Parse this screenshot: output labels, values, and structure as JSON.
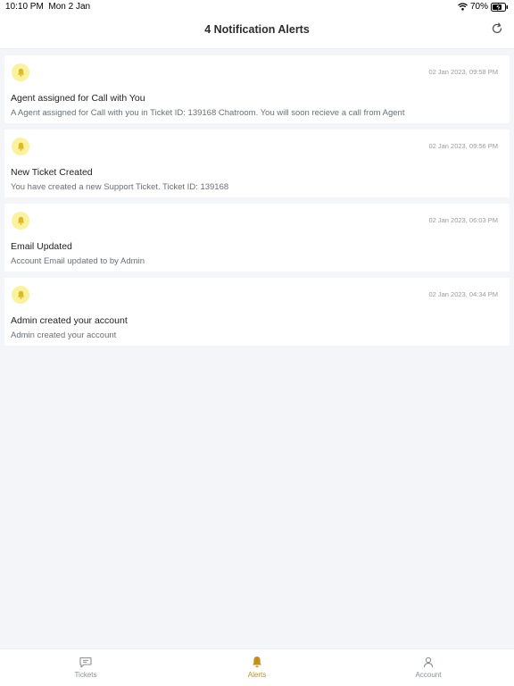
{
  "status_bar": {
    "time": "10:10 PM",
    "date": "Mon 2 Jan",
    "battery": "70%"
  },
  "header": {
    "title": "4 Notification Alerts",
    "refresh_icon": "refresh-icon"
  },
  "notifications": [
    {
      "time": "02 Jan 2023, 09:58 PM",
      "title": "Agent assigned for Call with You",
      "body": "A Agent assigned for Call with you in Ticket ID: 139168 Chatroom. You will soon recieve a call from Agent",
      "icon": "bell-icon"
    },
    {
      "time": "02 Jan 2023, 09:56 PM",
      "title": "New Ticket Created",
      "body": "You have created a new Support Ticket. Ticket ID: 139168",
      "icon": "bell-icon"
    },
    {
      "time": "02 Jan 2023, 06:03 PM",
      "title": "Email Updated",
      "body": "Account Email updated to  by Admin",
      "icon": "bell-icon"
    },
    {
      "time": "02 Jan 2023, 04:34 PM",
      "title": "Admin created your account",
      "body": "Admin created your account",
      "icon": "bell-icon"
    }
  ],
  "bottom_nav": {
    "items": [
      {
        "label": "Tickets",
        "icon": "chat-icon",
        "active": false
      },
      {
        "label": "Alerts",
        "icon": "bell-icon",
        "active": true
      },
      {
        "label": "Account",
        "icon": "user-icon",
        "active": false
      }
    ]
  },
  "colors": {
    "accent": "#c58f17",
    "bell_badge": "#fbf2a0",
    "background": "#f4f5f9"
  }
}
